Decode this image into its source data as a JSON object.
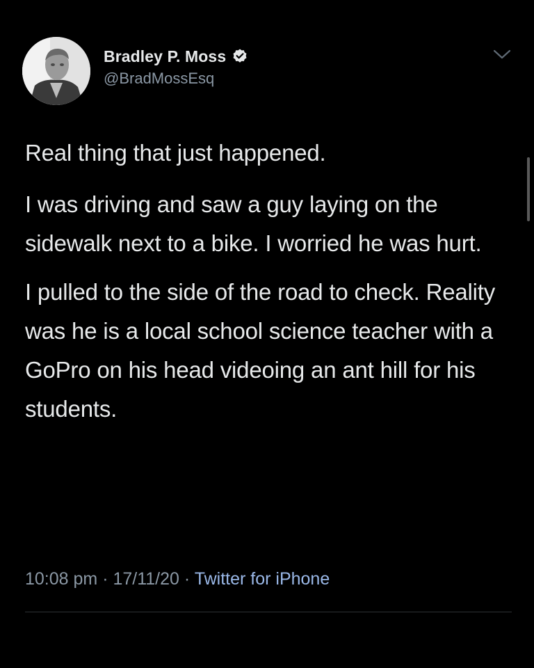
{
  "author": {
    "name": "Bradley P. Moss",
    "handle": "@BradMossEsq",
    "verified_icon": "verified-badge-icon"
  },
  "tweet": {
    "paragraphs": [
      "Real thing that just happened.",
      "I was driving and saw a guy laying on the sidewalk next to a bike. I worried he was hurt.",
      "I pulled to the side of the road to check. Reality was he is a local school science teacher with a GoPro on his head videoing an ant hill for his students."
    ]
  },
  "meta": {
    "time": "10:08 pm",
    "separator": " · ",
    "date": "17/11/20",
    "source": "Twitter for iPhone"
  },
  "colors": {
    "background": "#000000",
    "text": "#e7e9ea",
    "muted": "#8b98a5",
    "link": "#9ab8e8"
  }
}
